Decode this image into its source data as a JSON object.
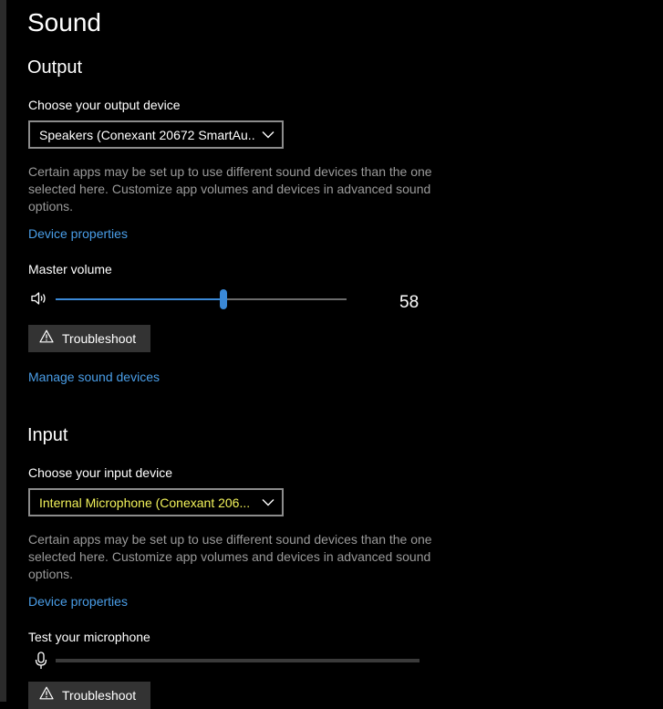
{
  "page": {
    "title": "Sound"
  },
  "output": {
    "title": "Output",
    "device_label": "Choose your output device",
    "device_value": "Speakers (Conexant 20672 SmartAu...",
    "help_text": "Certain apps may be set up to use different sound devices than the one selected here. Customize app volumes and devices in advanced sound options.",
    "device_properties_link": "Device properties",
    "volume_label": "Master volume",
    "volume_value": "58",
    "troubleshoot_label": "Troubleshoot",
    "manage_devices_link": "Manage sound devices",
    "volume_icon": "speaker-icon"
  },
  "input": {
    "title": "Input",
    "device_label": "Choose your input device",
    "device_value": "Internal Microphone (Conexant 206...",
    "help_text": "Certain apps may be set up to use different sound devices than the one selected here. Customize app volumes and devices in advanced sound options.",
    "device_properties_link": "Device properties",
    "test_label": "Test your microphone",
    "troubleshoot_label": "Troubleshoot",
    "mic_icon": "microphone-icon",
    "mic_level_percent": 0
  },
  "colors": {
    "background": "#000000",
    "accent": "#3a88d6",
    "link": "#4a9ee8",
    "input_device_text": "#f2f25a",
    "help_text": "#9a9a9a",
    "button_bg": "#333333"
  }
}
